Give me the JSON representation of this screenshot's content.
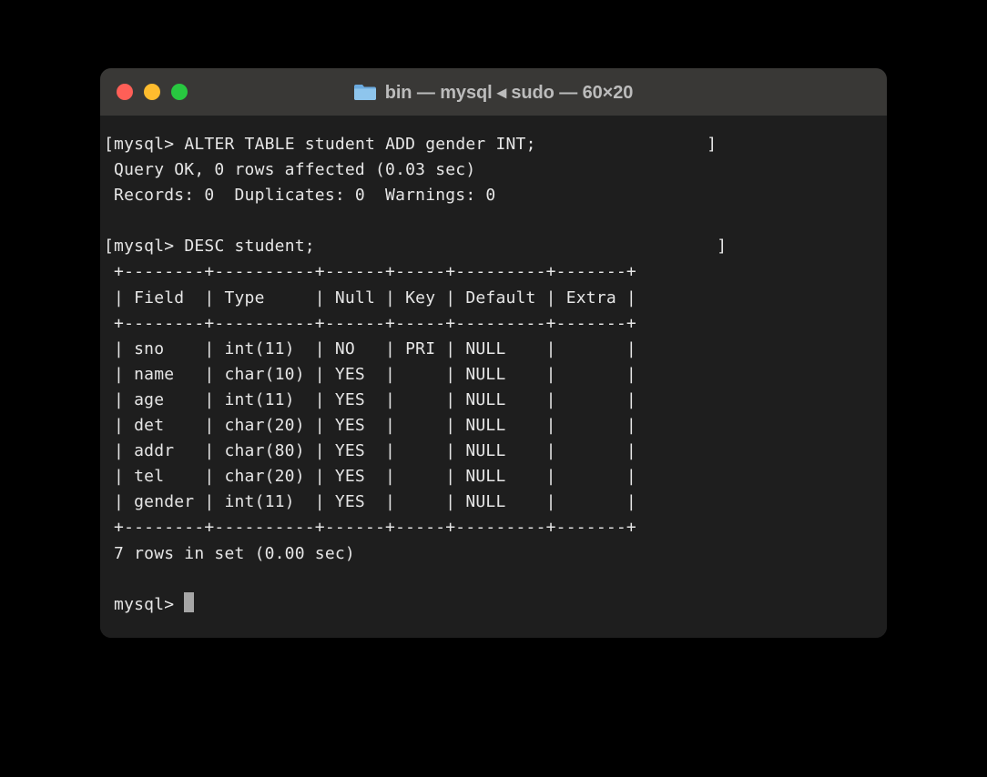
{
  "window": {
    "title": "bin — mysql ◂ sudo — 60×20"
  },
  "prompt": "mysql>",
  "brackets": {
    "open": "[",
    "close": "]"
  },
  "commands": {
    "alter": "ALTER TABLE student ADD gender INT;",
    "desc": "DESC student;"
  },
  "output": {
    "query_ok": "Query OK, 0 rows affected (0.03 sec)",
    "records": "Records: 0  Duplicates: 0  Warnings: 0",
    "summary": "7 rows in set (0.00 sec)"
  },
  "table": {
    "border": "+--------+----------+------+-----+---------+-------+",
    "header": "| Field  | Type     | Null | Key | Default | Extra |",
    "rows": [
      "| sno    | int(11)  | NO   | PRI | NULL    |       |",
      "| name   | char(10) | YES  |     | NULL    |       |",
      "| age    | int(11)  | YES  |     | NULL    |       |",
      "| det    | char(20) | YES  |     | NULL    |       |",
      "| addr   | char(80) | YES  |     | NULL    |       |",
      "| tel    | char(20) | YES  |     | NULL    |       |",
      "| gender | int(11)  | YES  |     | NULL    |       |"
    ]
  }
}
